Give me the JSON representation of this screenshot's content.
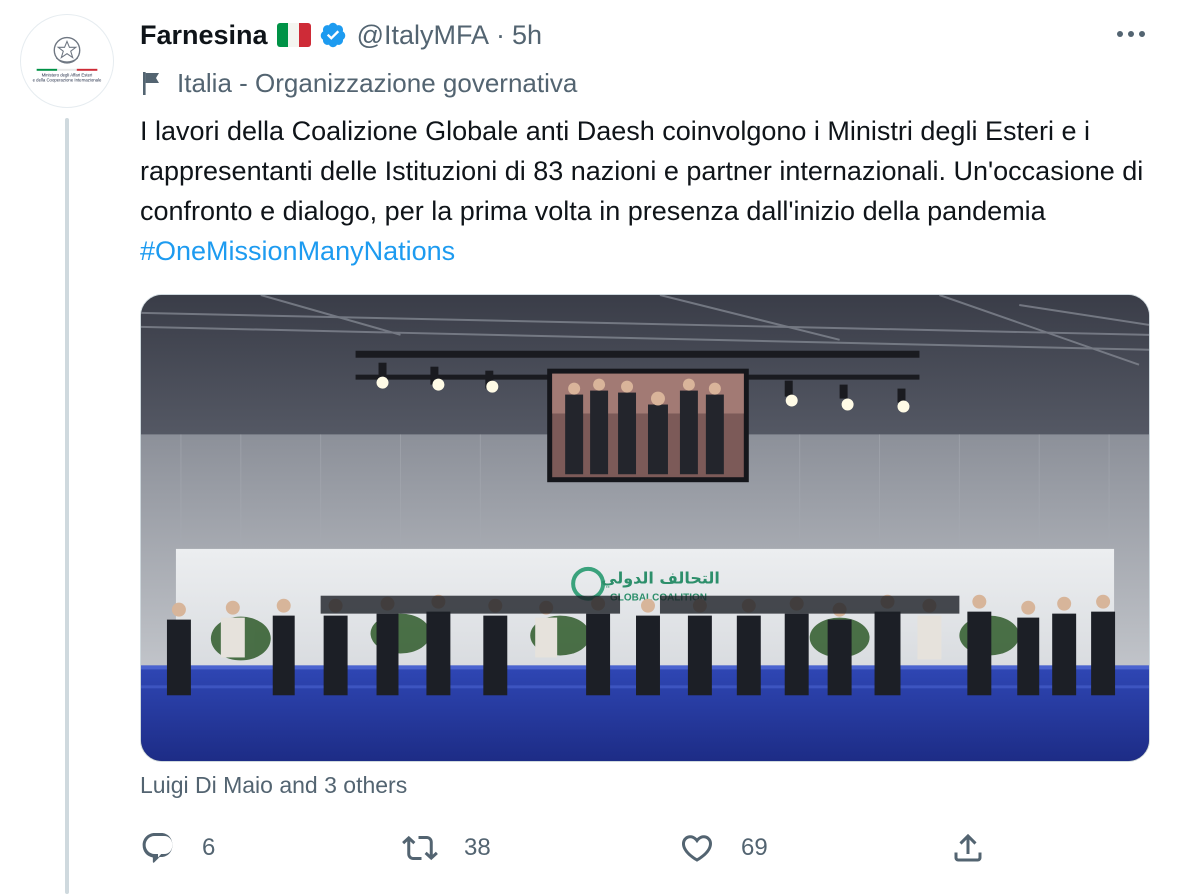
{
  "tweet": {
    "author_name": "Farnesina",
    "handle": "@ItalyMFA",
    "separator": "·",
    "time": "5h",
    "label": "Italia - Organizzazione governativa",
    "text": "I lavori della Coalizione Globale anti Daesh coinvolgono i Ministri degli Esteri e i rappresentanti delle Istituzioni di 83 nazioni e partner internazionali. Un'occasione di confronto e dialogo, per la prima volta in presenza dall'inizio della pandemia",
    "hashtag": "#OneMissionManyNations",
    "tagged": "Luigi Di Maio and 3 others",
    "avatar_caption_line1": "Ministero degli Affari Esteri",
    "avatar_caption_line2": "e della Cooperazione Internazionale"
  },
  "media": {
    "banner_arabic": "التحالف الدولي",
    "banner_latin": "GLOBALCOALITION"
  },
  "actions": {
    "reply_count": "6",
    "retweet_count": "38",
    "like_count": "69"
  },
  "colors": {
    "accent": "#1d9bf0",
    "secondary_text": "#536471",
    "flag_green": "#009246",
    "flag_white": "#ffffff",
    "flag_red": "#ce2b37"
  },
  "icons": [
    "more-icon",
    "verified-badge-icon",
    "flag-label-icon",
    "reply-icon",
    "retweet-icon",
    "like-icon",
    "share-icon"
  ]
}
